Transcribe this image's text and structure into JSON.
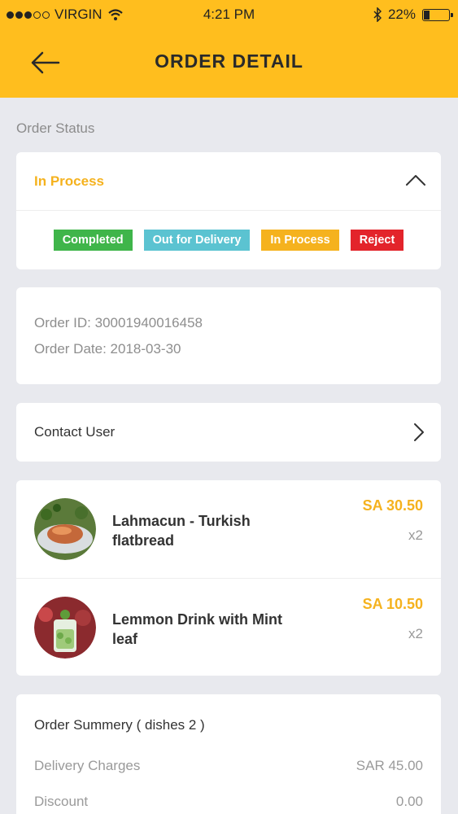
{
  "status_bar": {
    "carrier": "VIRGIN",
    "time": "4:21 PM",
    "battery": "22%",
    "battery_level": 0.22
  },
  "header": {
    "title": "ORDER DETAIL",
    "back_icon": "arrow-left-icon"
  },
  "order_status": {
    "section_label": "Order Status",
    "current": "In Process",
    "options": [
      {
        "label": "Completed",
        "color": "#3fb54a"
      },
      {
        "label": "Out for Delivery",
        "color": "#5bc3d1"
      },
      {
        "label": "In Process",
        "color": "#f5b21e"
      },
      {
        "label": "Reject",
        "color": "#e3242b"
      }
    ]
  },
  "order_info": {
    "id_line": "Order ID: 30001940016458",
    "date_line": "Order Date: 2018-03-30"
  },
  "contact": {
    "label": "Contact User"
  },
  "items": [
    {
      "name": "Lahmacun - Turkish flatbread",
      "price": "SA 30.50",
      "qty": "x2"
    },
    {
      "name": "Lemmon Drink with Mint leaf",
      "price": "SA 10.50",
      "qty": "x2"
    }
  ],
  "summary": {
    "title": "Order Summery ( dishes 2 )",
    "rows": [
      {
        "label": "Delivery Charges",
        "value": "SAR 45.00"
      },
      {
        "label": "Discount",
        "value": "0.00"
      }
    ]
  }
}
